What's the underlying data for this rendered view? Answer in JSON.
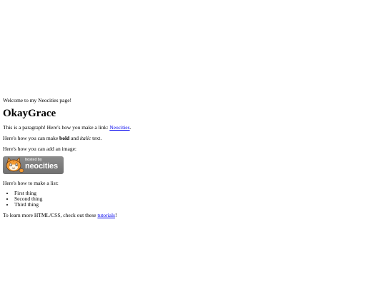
{
  "welcome_text": "Welcome to my Neocities page!",
  "title": "OkayGrace",
  "para1": {
    "before": "This is a paragraph! Here's how you make a link: ",
    "link": "Neocities",
    "after": "."
  },
  "para2": {
    "before": "Here's how you can make ",
    "bold": "bold",
    "middle": " and ",
    "italic": "italic",
    "after": " text."
  },
  "para3": "Here's how you can add an image:",
  "badge": {
    "small_text": "hosted by",
    "brand_text": "neocities"
  },
  "para4": "Here's how to make a list:",
  "list_items": [
    "First thing",
    "Second thing",
    "Third thing"
  ],
  "para5": {
    "before": "To learn more HTML/CSS, check out these ",
    "link": "tutorials",
    "after": "!"
  },
  "colors": {
    "link": "#0000ee",
    "badge_bg": "#808080",
    "cat_orange": "#f39c34"
  }
}
